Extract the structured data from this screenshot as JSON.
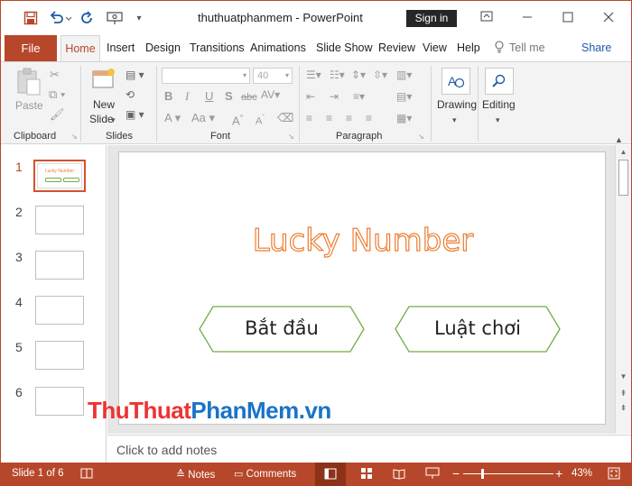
{
  "title_bar": {
    "document_title": "thuthuatphanmem  -  PowerPoint",
    "signin_label": "Sign in",
    "icons": [
      "save-icon",
      "undo-icon",
      "redo-icon",
      "present-icon",
      "customize-icon",
      "ribbon-display-icon",
      "minimize-icon",
      "maximize-icon",
      "close-icon"
    ]
  },
  "tabs": {
    "file": "File",
    "home": "Home",
    "insert": "Insert",
    "design": "Design",
    "transitions": "Transitions",
    "animations": "Animations",
    "slide_show": "Slide Show",
    "review": "Review",
    "view": "View",
    "help": "Help",
    "tell_me": "Tell me",
    "share": "Share"
  },
  "ribbon": {
    "clipboard": {
      "label": "Clipboard",
      "paste": "Paste"
    },
    "slides": {
      "label": "Slides",
      "new_slide_line1": "New",
      "new_slide_line2": "Slide"
    },
    "font": {
      "label": "Font",
      "font_name": "",
      "font_size": "40"
    },
    "paragraph": {
      "label": "Paragraph"
    },
    "drawing": {
      "label": "Drawing"
    },
    "editing": {
      "label": "Editing"
    }
  },
  "slide_panel": {
    "slides": [
      {
        "number": "1",
        "thumb_title": "Lucky Number"
      },
      {
        "number": "2"
      },
      {
        "number": "3"
      },
      {
        "number": "4"
      },
      {
        "number": "5"
      },
      {
        "number": "6"
      }
    ]
  },
  "slide": {
    "title": "Lucky Number",
    "button_start": "Bắt đầu",
    "button_rules": "Luật chơi"
  },
  "watermark": {
    "part1": "ThuThuat",
    "part2": "PhanMem",
    "part3": ".vn"
  },
  "notes": {
    "placeholder": "Click to add notes"
  },
  "status_bar": {
    "slide_info": "Slide 1 of 6",
    "notes": "Notes",
    "comments": "Comments",
    "zoom_level": "43%",
    "zoom_fraction": 0.2
  },
  "colors": {
    "accent": "#b7472a",
    "title_outline": "#ed7d31",
    "button_outline": "#70ad47",
    "watermark_red": "#e33333",
    "watermark_blue": "#1a73c8"
  }
}
